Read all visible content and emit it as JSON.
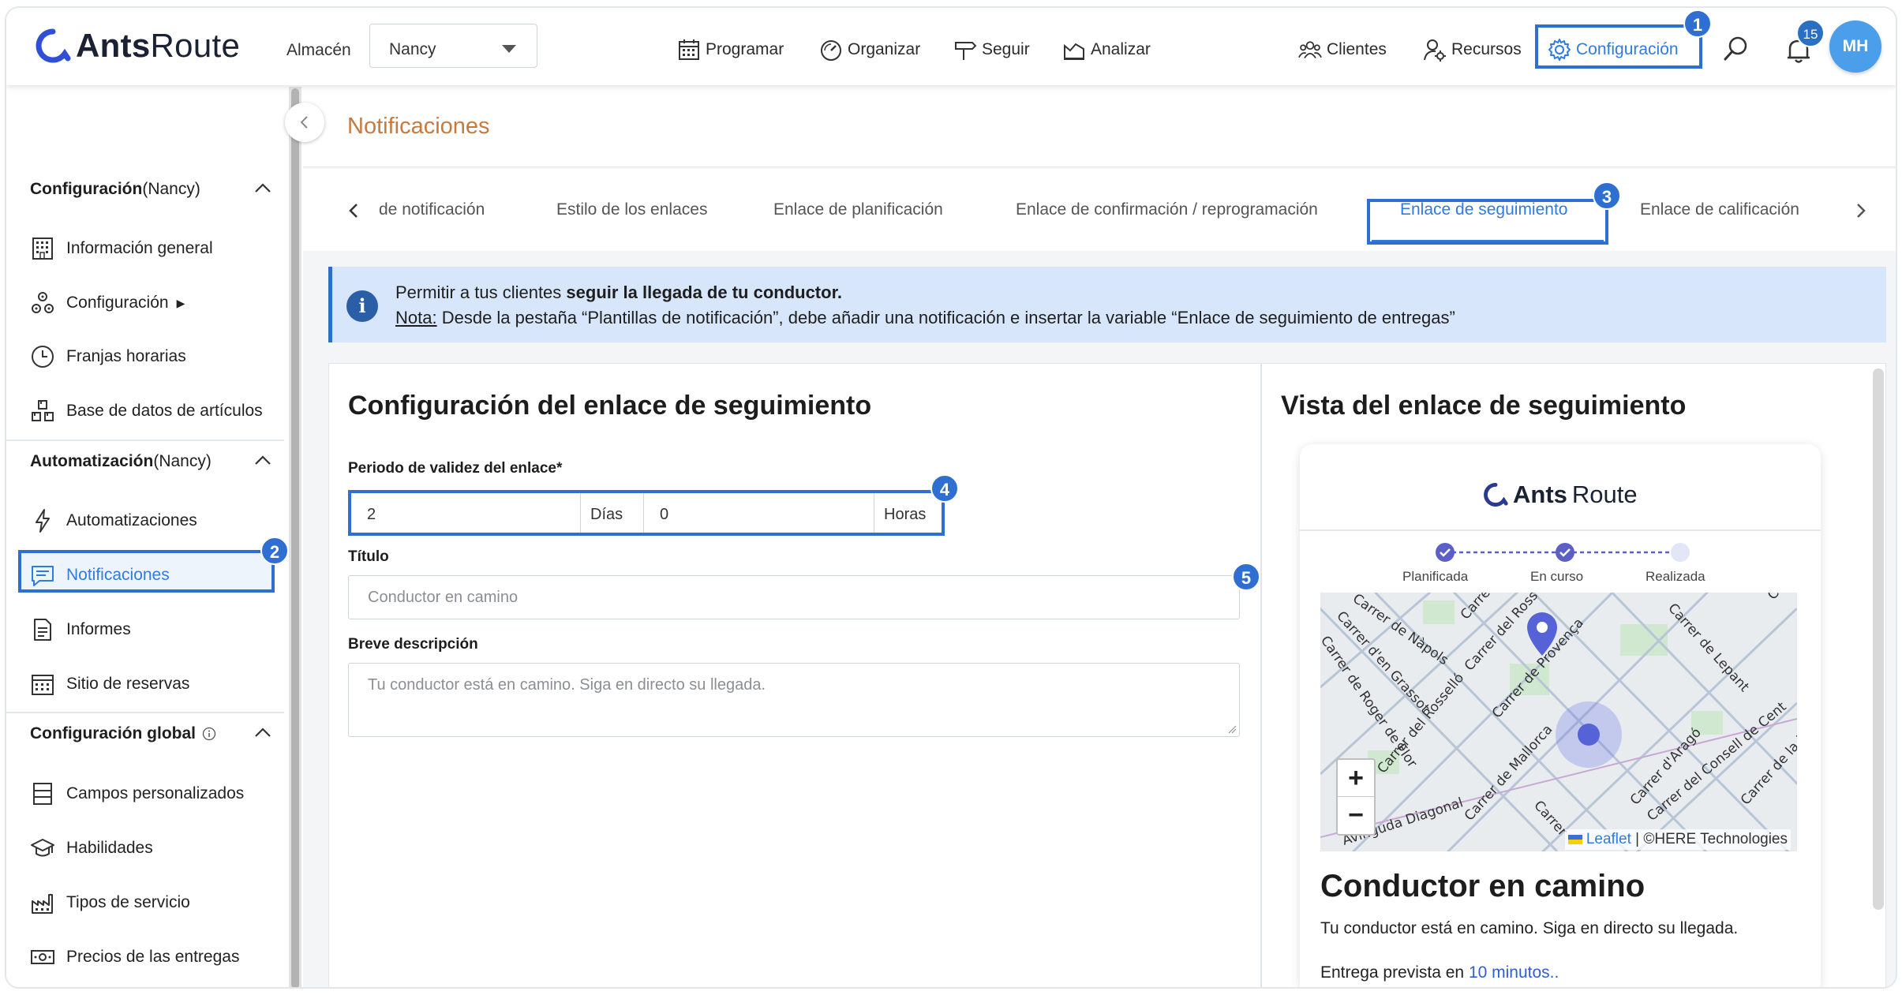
{
  "app": {
    "logo_text_bold": "Ants",
    "logo_text_regular": "Route"
  },
  "header": {
    "warehouse_label": "Almacén",
    "warehouse_value": "Nancy",
    "nav": [
      {
        "label": "Programar",
        "icon": "calendar-icon"
      },
      {
        "label": "Organizar",
        "icon": "gauge-icon"
      },
      {
        "label": "Seguir",
        "icon": "signpost-icon"
      },
      {
        "label": "Analizar",
        "icon": "chart-icon"
      }
    ],
    "right_nav": [
      {
        "label": "Clientes",
        "icon": "clients-icon"
      },
      {
        "label": "Recursos",
        "icon": "resources-icon"
      },
      {
        "label": "Configuración",
        "icon": "gear-icon"
      }
    ],
    "notification_count": "15",
    "avatar_initials": "MH"
  },
  "callouts": [
    "1",
    "2",
    "3",
    "4",
    "5"
  ],
  "sidebar": {
    "sections": [
      {
        "title_bold": "Configuración",
        "title_suffix": " (Nancy)",
        "items": [
          "Información general",
          "Configuración",
          "Franjas horarias",
          "Base de datos de artículos"
        ]
      },
      {
        "title_bold": "Automatización",
        "title_suffix": " (Nancy)",
        "items": [
          "Automatizaciones",
          "Notificaciones",
          "Informes",
          "Sitio de reservas"
        ]
      },
      {
        "title_bold": "Configuración global",
        "title_suffix": "",
        "items": [
          "Campos personalizados",
          "Habilidades",
          "Tipos de servicio",
          "Precios de las entregas"
        ]
      }
    ],
    "submenu_arrow": "▶"
  },
  "page": {
    "title": "Notificaciones",
    "tabs": [
      "de notificación",
      "Estilo de los enlaces",
      "Enlace de planificación",
      "Enlace de confirmación / reprogramación",
      "Enlace de seguimiento",
      "Enlace de calificación"
    ],
    "active_tab": "Enlace de seguimiento"
  },
  "info": {
    "line1_prefix": "Permitir a tus clientes ",
    "line1_bold": "seguir la llegada de tu conductor.",
    "line2_note": "Nota:",
    "line2_text": " Desde la pestaña “Plantillas de notificación”, debe añadir una notificación e insertar la variable “Enlace de seguimiento de entregas”"
  },
  "form": {
    "heading": "Configuración del enlace de seguimiento",
    "validity_label": "Periodo de validez del enlace*",
    "days_value": "2",
    "days_unit": "Días",
    "hours_value": "0",
    "hours_unit": "Horas",
    "title_label": "Título",
    "title_placeholder": "Conductor en camino",
    "desc_label": "Breve descripción",
    "desc_placeholder": "Tu conductor está en camino. Siga en directo su llegada."
  },
  "preview": {
    "heading": "Vista del enlace de seguimiento",
    "steps": [
      "Planificada",
      "En curso",
      "Realizada"
    ],
    "map_streets": [
      "Carrer de Nàpols",
      "Carrer d'en Grassot",
      "Carrer de Roger de Flor",
      "Carrer del Ross",
      "Carrer de Provença",
      "Carrer de Lepant",
      "Carrer de Mallorca",
      "Carrer d'Aragó",
      "Carrer del Consell de Cent",
      "Carrer de la Diputació",
      "Carrer del Rosselló",
      "Avinguda Diagonal",
      "Carrer",
      "Carrer",
      "Ca"
    ],
    "zoom_in": "+",
    "zoom_out": "−",
    "attribution_link": "Leaflet",
    "attribution_text": " | ©HERE Technologies",
    "title": "Conductor en camino",
    "description": "Tu conductor está en camino. Siga en directo su llegada.",
    "eta_prefix": "Entrega prevista en ",
    "eta_value": "10 minutos.."
  },
  "colors": {
    "accent": "#2f7be0",
    "highlight_border": "#2f6fd1",
    "page_title": "#c77a3f",
    "info_bg": "#d7e6fb"
  }
}
